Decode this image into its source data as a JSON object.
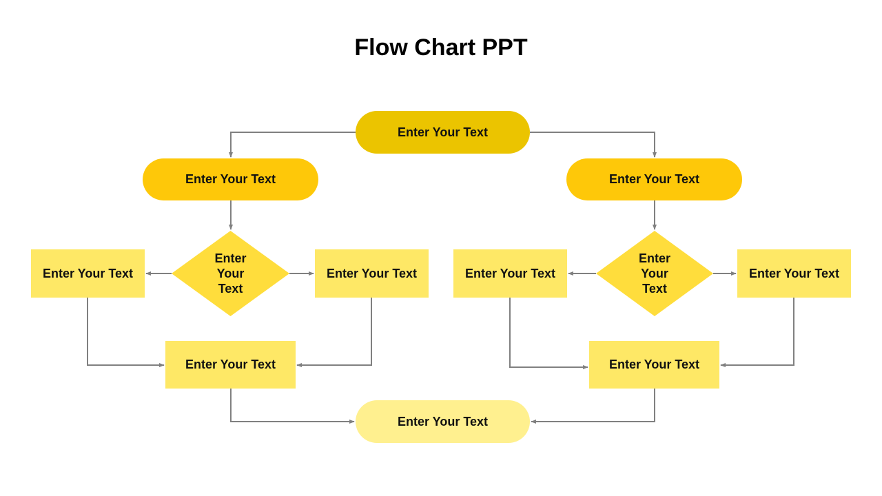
{
  "title": "Flow Chart PPT",
  "colors": {
    "start": "#ebc400",
    "branch": "#fec809",
    "decision": "#ffdd3c",
    "process": "#fee866",
    "end": "#fff08f",
    "connector": "#808080"
  },
  "nodes": {
    "start": "Enter Your Text",
    "left_branch": "Enter Your Text",
    "right_branch": "Enter Your Text",
    "left_decision": "Enter Your Text",
    "right_decision": "Enter Your Text",
    "left_option_a": "Enter Your Text",
    "left_option_b": "Enter Your Text",
    "right_option_a": "Enter Your Text",
    "right_option_b": "Enter Your Text",
    "left_merge": "Enter Your Text",
    "right_merge": "Enter Your Text",
    "end": "Enter Your Text"
  }
}
